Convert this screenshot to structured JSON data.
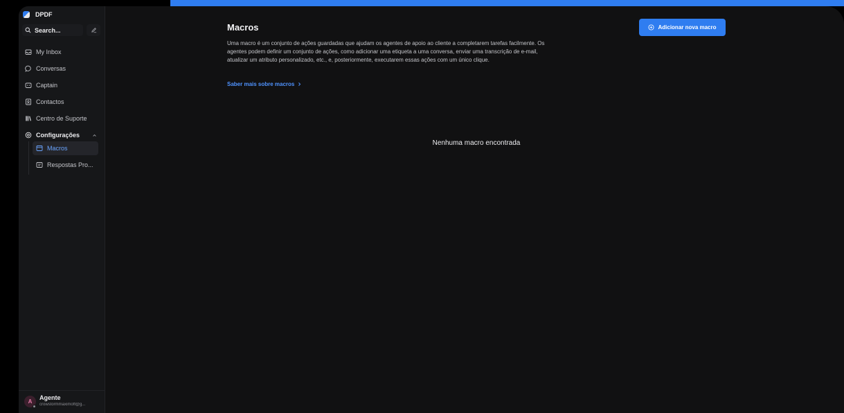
{
  "workspace": {
    "name": "DPDF"
  },
  "search": {
    "label": "Search..."
  },
  "nav": {
    "items": [
      {
        "label": "My Inbox",
        "icon": "inbox-icon"
      },
      {
        "label": "Conversas",
        "icon": "chat-bubble-icon"
      },
      {
        "label": "Captain",
        "icon": "bot-icon"
      },
      {
        "label": "Contactos",
        "icon": "contacts-icon"
      },
      {
        "label": "Centro de Suporte",
        "icon": "library-icon"
      },
      {
        "label": "Configurações",
        "icon": "gear-icon"
      }
    ],
    "settings_sub": [
      {
        "label": "Macros",
        "icon": "macro-icon",
        "active": true
      },
      {
        "label": "Respostas Pro...",
        "icon": "canned-response-icon",
        "active": false
      }
    ]
  },
  "user": {
    "initial": "A",
    "name": "Agente",
    "email": "crowstormmaximoff@g..."
  },
  "page": {
    "title": "Macros",
    "description": "Uma macro é um conjunto de ações guardadas que ajudam os agentes de apoio ao cliente a completarem tarefas facilmente. Os agentes podem definir um conjunto de ações, como adicionar uma etiqueta a uma conversa, enviar uma transcrição de e-mail, atualizar um atributo personalizado, etc., e, posteriormente, executarem essas ações com um único clique.",
    "learn_more": "Saber mais sobre macros",
    "add_button": "Adicionar nova macro",
    "empty_state": "Nenhuma macro encontrada"
  },
  "colors": {
    "accent": "#2f7df0",
    "link": "#4f93ff",
    "background": "#111112",
    "sidebar": "#161719"
  }
}
